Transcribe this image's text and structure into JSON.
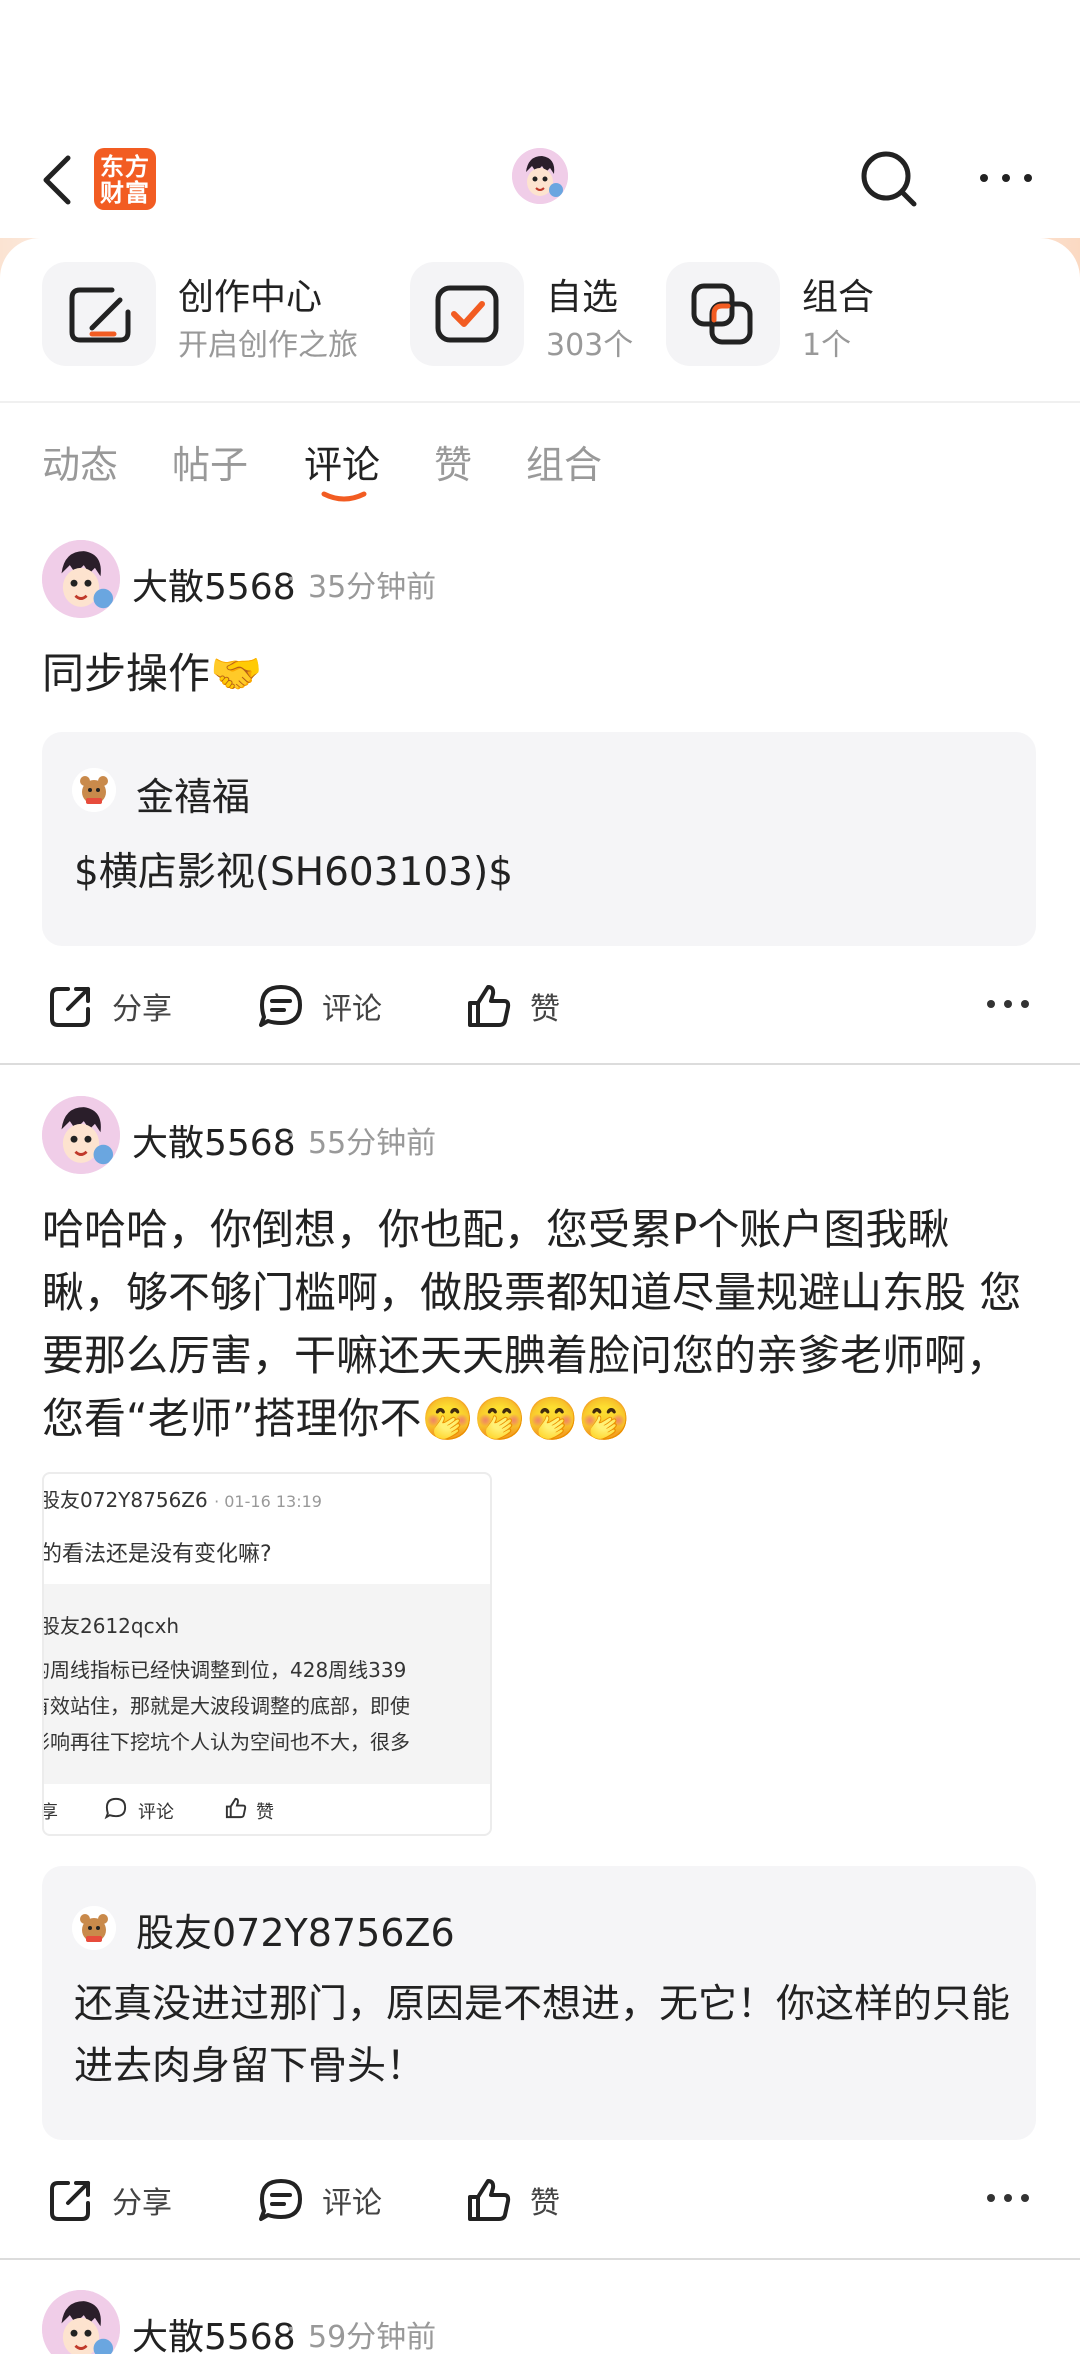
{
  "header": {
    "logo_line1": "东方",
    "logo_line2": "财富"
  },
  "shortcuts": [
    {
      "title": "创作中心",
      "subtitle": "开启创作之旅"
    },
    {
      "title": "自选",
      "subtitle": "303个"
    },
    {
      "title": "组合",
      "subtitle": "1个"
    }
  ],
  "tabs": [
    "动态",
    "帖子",
    "评论",
    "赞",
    "组合"
  ],
  "active_tab": "评论",
  "accent_color": "#f25c22",
  "posts": [
    {
      "author": "大散5568",
      "dot": "·",
      "time": "35分钟前",
      "content": "同步操作🤝",
      "quote": {
        "name": "金禧福",
        "text": "$横店影视(SH603103)$"
      }
    },
    {
      "author": "大散5568",
      "dot": "·",
      "time": "55分钟前",
      "content": "哈哈哈，你倒想，你也配，您受累P个账户图我瞅瞅，够不够门槛啊，做股票都知道尽量规避山东股  您要那么厉害，干嘛还天天腆着脸问您的亲爹老师啊，您看“老师”搭理你不🤭🤭🤭🤭",
      "image": {
        "user1": "股友072Y8756Z6",
        "meta": "· 01-16 13:19",
        "line1": "的看法还是没有变化嘛?",
        "user2": "股友2612qcxh",
        "line2": "的周线指标已经快调整到位，428周线339",
        "line3": "有效站住，那就是大波段调整的底部，即使",
        "line4": "影响再往下挖坑个人认为空间也不大，很多",
        "share": "享",
        "comment": "评论",
        "like": "赞"
      },
      "quote": {
        "name": "股友072Y8756Z6",
        "text": "还真没进过那门，原因是不想进，无它！你这样的只能进去肉身留下骨头！"
      }
    },
    {
      "author": "大散5568",
      "dot": "·",
      "time": "59分钟前"
    }
  ],
  "actions": {
    "share": "分享",
    "comment": "评论",
    "like": "赞"
  },
  "icons": [
    "back-icon",
    "search-icon",
    "more-icon",
    "pen-icon",
    "check-icon",
    "portfolio-icon",
    "share-icon",
    "comment-icon",
    "thumbs-up-icon"
  ]
}
